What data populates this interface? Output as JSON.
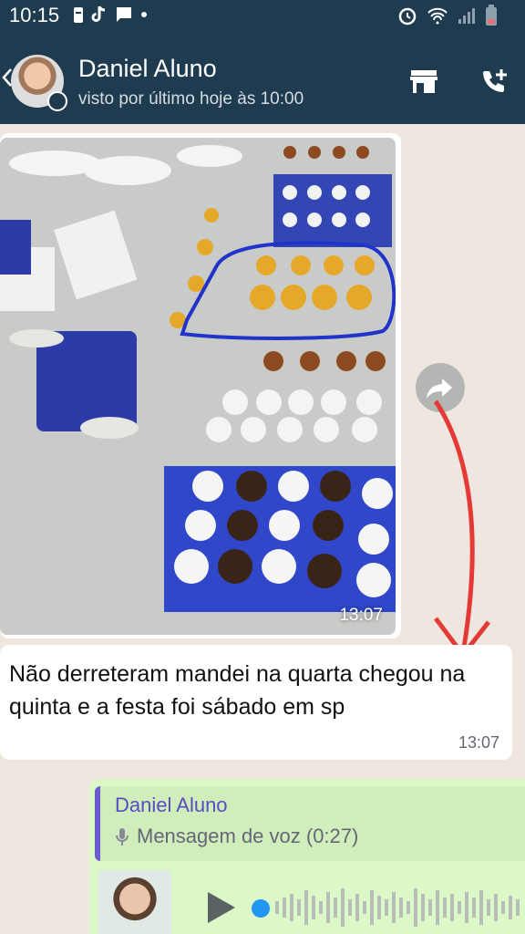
{
  "status_bar": {
    "time": "10:15",
    "left_icons": [
      "battery-saver-icon",
      "tiktok-icon",
      "chat-bubble-icon",
      "dot-icon"
    ],
    "right_icons": [
      "alarm-icon",
      "wifi-icon",
      "signal-icon",
      "battery-icon"
    ]
  },
  "header": {
    "contact_name": "Daniel Aluno",
    "last_seen": "visto por último hoje às 10:00",
    "actions": [
      "store-icon",
      "add-call-icon"
    ]
  },
  "messages": [
    {
      "type": "image",
      "time": "13:07"
    },
    {
      "type": "text",
      "text": "Não derreteram mandei na quarta chegou na quinta e a festa foi sábado em sp",
      "time": "13:07"
    }
  ],
  "reply": {
    "quoted_name": "Daniel Aluno",
    "quoted_text": "Mensagem de voz (0:27)"
  },
  "colors": {
    "header": "#1f3b4f",
    "chat_bg": "#efe7df",
    "outgoing": "#dcf8c6",
    "accent": "#2196f3",
    "annotation": "#e53935"
  }
}
